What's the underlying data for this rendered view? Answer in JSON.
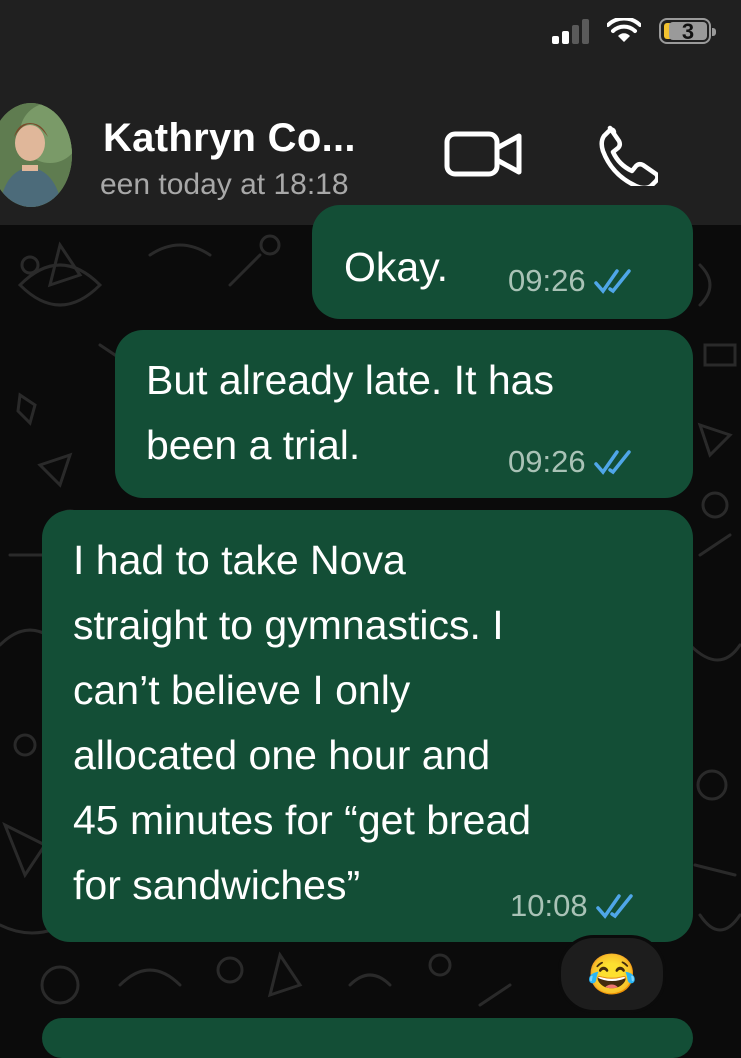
{
  "status_bar": {
    "battery_level": "3"
  },
  "header": {
    "contact_name": "Kathryn Co...",
    "last_seen": "een today at 18:18"
  },
  "messages": [
    {
      "text": "Okay.",
      "time": "09:26",
      "status": "read"
    },
    {
      "text": "But already late. It has\nbeen a trial.",
      "time": "09:26",
      "status": "read"
    },
    {
      "text": "I had to take Nova\nstraight to gymnastics. I\ncan’t believe I only\nallocated one hour and\n45 minutes for “get bread\nfor sandwiches”",
      "time": "10:08",
      "status": "read",
      "reaction": "😂"
    }
  ],
  "colors": {
    "outgoing_bubble": "#134e36",
    "header_bg": "#202020",
    "read_tick": "#4fa6e8"
  }
}
